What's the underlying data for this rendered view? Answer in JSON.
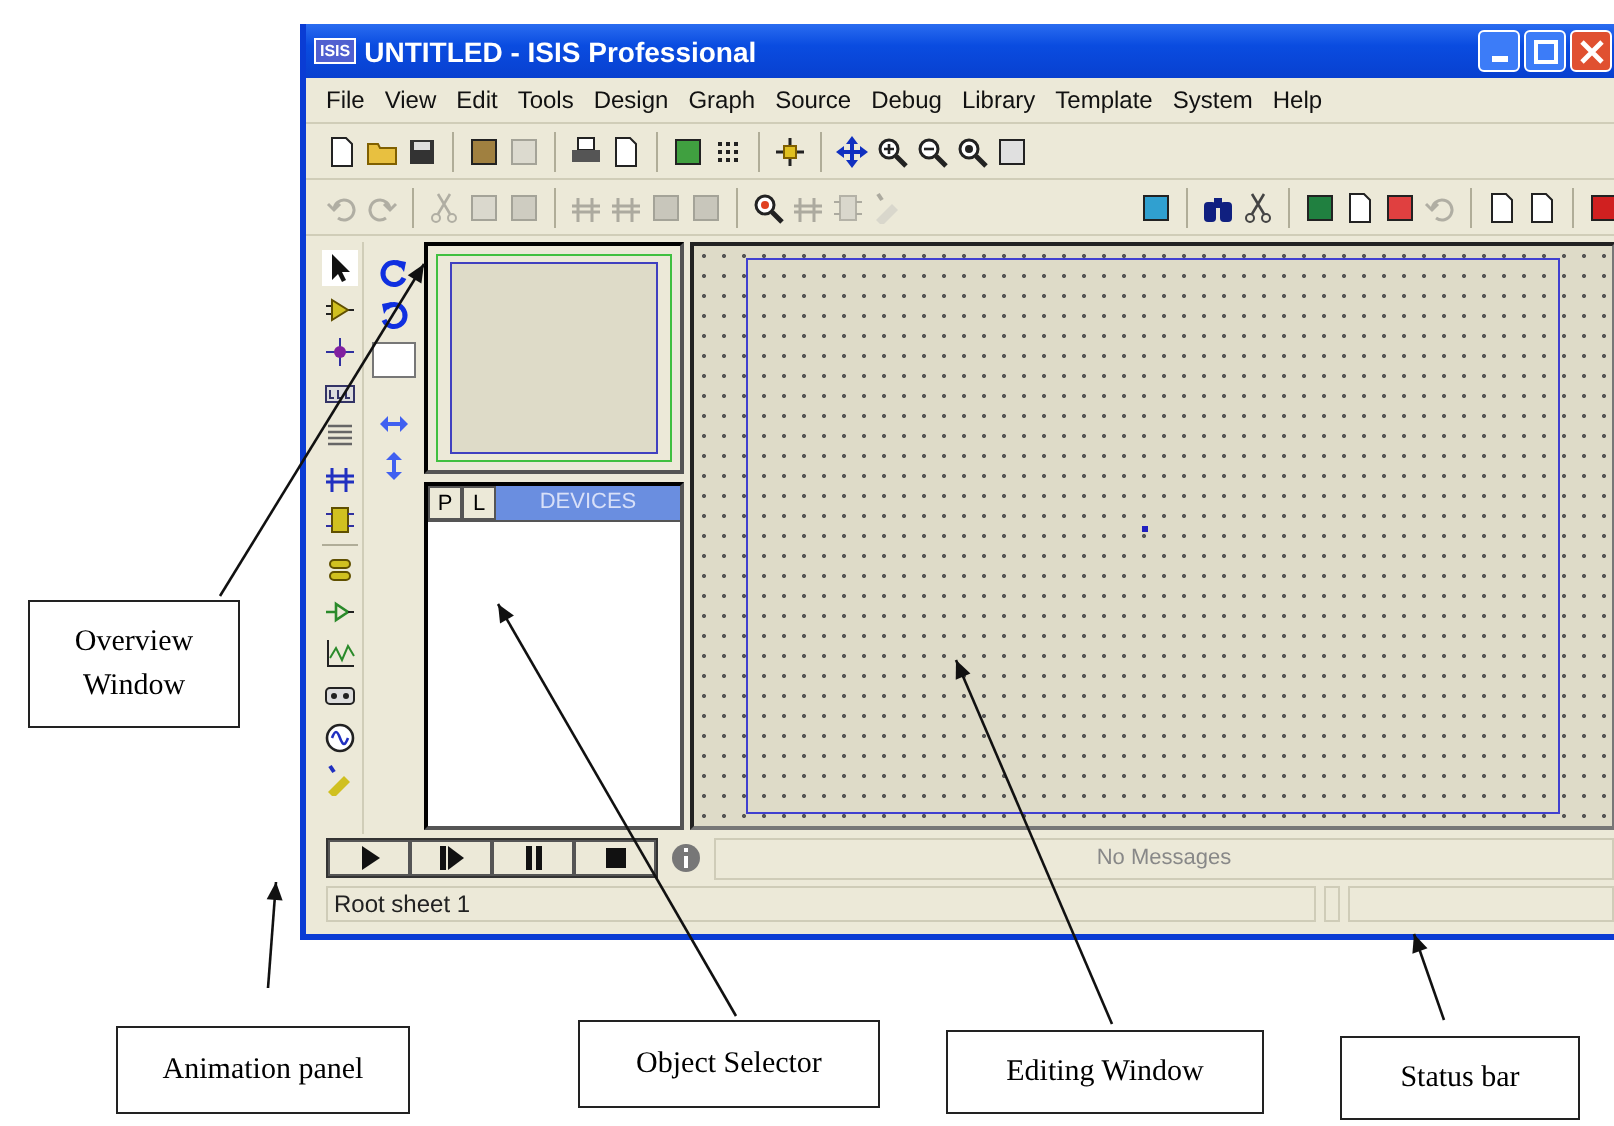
{
  "window": {
    "title": "UNTITLED - ISIS Professional",
    "app_badge": "ISIS"
  },
  "menu": [
    "File",
    "View",
    "Edit",
    "Tools",
    "Design",
    "Graph",
    "Source",
    "Debug",
    "Library",
    "Template",
    "System",
    "Help"
  ],
  "toolbar_1": [
    {
      "disabled": false
    },
    {
      "disabled": false
    },
    {
      "disabled": false
    },
    {
      "disabled": false
    },
    {
      "disabled": true
    },
    {
      "disabled": false
    },
    {
      "disabled": false
    },
    {
      "disabled": false
    },
    {
      "disabled": false
    },
    {
      "disabled": false
    },
    {
      "disabled": false
    },
    {
      "disabled": false
    },
    {
      "disabled": false
    },
    {
      "disabled": false
    },
    {
      "disabled": false
    }
  ],
  "toolbar_2": [
    {
      "disabled": true
    },
    {
      "disabled": true
    },
    {
      "disabled": true
    },
    {
      "disabled": true
    },
    {
      "disabled": true
    },
    {
      "disabled": true
    },
    {
      "disabled": true
    },
    {
      "disabled": true
    },
    {
      "disabled": true
    },
    {
      "disabled": false
    },
    {
      "disabled": true
    },
    {
      "disabled": true
    },
    {
      "disabled": true
    },
    {
      "disabled": false
    },
    {
      "disabled": false
    },
    {
      "disabled": false
    },
    {
      "disabled": false
    },
    {
      "disabled": false
    },
    {
      "disabled": false
    },
    {
      "disabled": true
    },
    {
      "disabled": false
    },
    {
      "disabled": false
    },
    {
      "disabled": false
    }
  ],
  "mode_tools": [
    {
      "selected": true
    },
    {
      "selected": false
    },
    {
      "selected": false
    },
    {
      "selected": false
    },
    {
      "selected": false
    },
    {
      "selected": false
    },
    {
      "selected": false
    },
    {
      "selected": false
    },
    {
      "selected": false
    },
    {
      "selected": false
    },
    {
      "selected": false
    },
    {
      "selected": false
    },
    {
      "selected": false
    }
  ],
  "object_selector": {
    "tabs": [
      {
        "label": "P"
      },
      {
        "label": "L"
      }
    ],
    "title": "DEVICES"
  },
  "messages": "No Messages",
  "status_bar": {
    "sheet": "Root sheet 1"
  },
  "callouts": [
    {
      "label": "Overview Window"
    },
    {
      "label": "Animation panel"
    },
    {
      "label": "Object Selector"
    },
    {
      "label": "Editing Window"
    },
    {
      "label": "Status bar"
    }
  ]
}
